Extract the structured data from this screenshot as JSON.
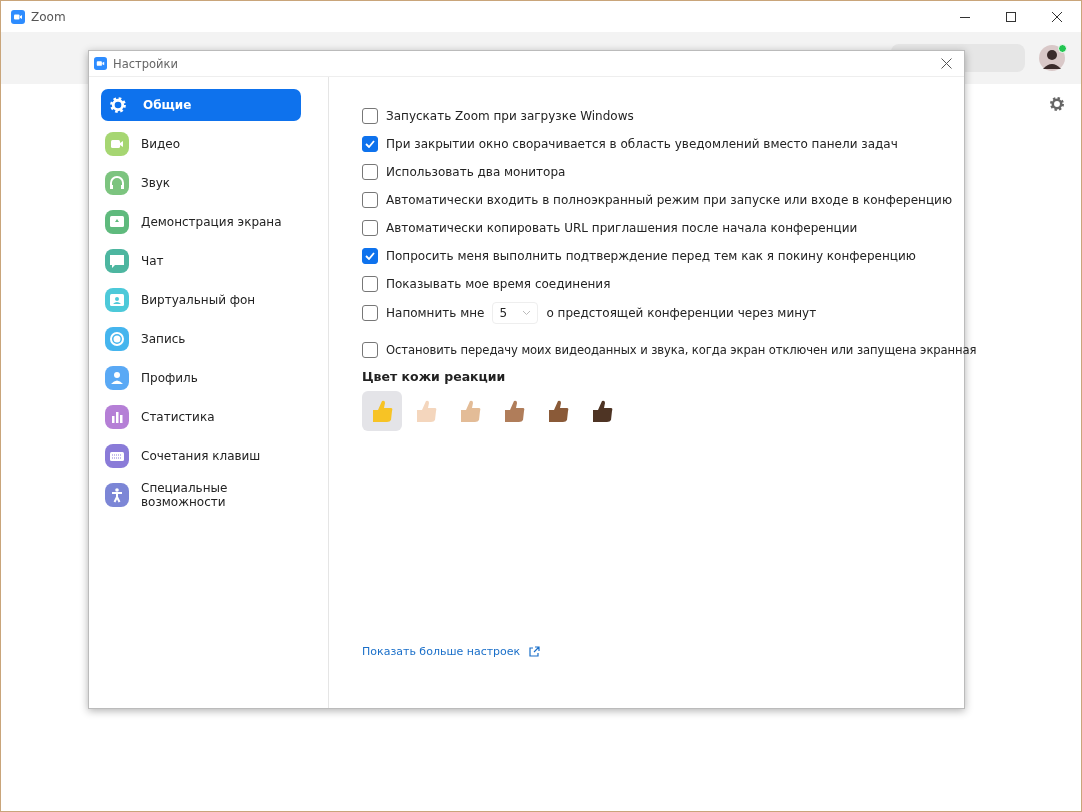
{
  "window": {
    "title": "Zoom"
  },
  "dialog": {
    "title": "Настройки"
  },
  "sidebar": {
    "items": [
      {
        "label": "Общие",
        "selected": true
      },
      {
        "label": "Видео",
        "selected": false
      },
      {
        "label": "Звук",
        "selected": false
      },
      {
        "label": "Демонстрация экрана",
        "selected": false
      },
      {
        "label": "Чат",
        "selected": false
      },
      {
        "label": "Виртуальный фон",
        "selected": false
      },
      {
        "label": "Запись",
        "selected": false
      },
      {
        "label": "Профиль",
        "selected": false
      },
      {
        "label": "Статистика",
        "selected": false
      },
      {
        "label": "Сочетания клавиш",
        "selected": false
      },
      {
        "label": "Специальные возможности",
        "selected": false
      }
    ]
  },
  "options": [
    {
      "kind": "plain",
      "label": "Запускать Zoom при загрузке Windows",
      "checked": false
    },
    {
      "kind": "plain",
      "label": "При закрытии окно сворачивается в область уведомлений вместо панели задач",
      "checked": true
    },
    {
      "kind": "plain",
      "label": "Использовать два монитора",
      "checked": false
    },
    {
      "kind": "plain",
      "label": "Автоматически входить в полноэкранный режим при запуске или входе в конференцию",
      "checked": false
    },
    {
      "kind": "plain",
      "label": "Автоматически копировать URL приглашения после начала конференции",
      "checked": false
    },
    {
      "kind": "plain",
      "label": "Попросить меня выполнить подтверждение перед тем как я покину конференцию",
      "checked": true
    },
    {
      "kind": "plain",
      "label": "Показывать мое время соединения",
      "checked": false
    },
    {
      "kind": "reminder",
      "label": "Напомнить мне",
      "value": "5",
      "suffix": "о предстоящей конференции через минут",
      "checked": false
    },
    {
      "kind": "plain",
      "label": "Остановить передачу моих видеоданных и звука, когда экран отключен или запущена экранная",
      "checked": false
    }
  ],
  "skin_tone": {
    "title": "Цвет кожи реакции",
    "tones": [
      {
        "color": "#f7c325",
        "selected": true
      },
      {
        "color": "#f4d6bd",
        "selected": false
      },
      {
        "color": "#e3bc97",
        "selected": false
      },
      {
        "color": "#b07d5a",
        "selected": false
      },
      {
        "color": "#8a5a38",
        "selected": false
      },
      {
        "color": "#4e3424",
        "selected": false
      }
    ]
  },
  "more_link": "Показать больше настроек"
}
